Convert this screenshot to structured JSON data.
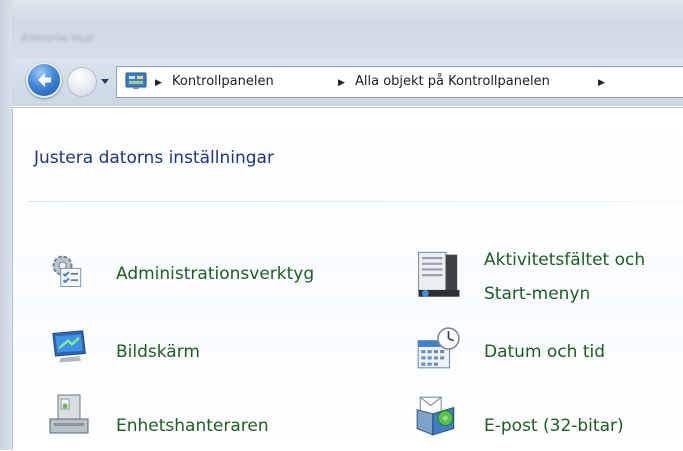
{
  "window": {
    "blurred_title": "Enterprise Vault"
  },
  "address_bar": {
    "breadcrumbs": [
      {
        "label": "Kontrollpanelen"
      },
      {
        "label": "Alla objekt på Kontrollpanelen"
      }
    ]
  },
  "main": {
    "title": "Justera datorns inställningar",
    "items": [
      {
        "label": "Administrationsverktyg",
        "icon": "admin-tools-icon"
      },
      {
        "label_line1": "Aktivitetsfältet och",
        "label_line2": "Start-menyn",
        "icon": "taskbar-icon"
      },
      {
        "label": "Bildskärm",
        "icon": "display-icon"
      },
      {
        "label": "Datum och tid",
        "icon": "calendar-clock-icon"
      },
      {
        "label": "Enhetshanteraren",
        "icon": "device-manager-icon"
      },
      {
        "label": "E-post (32-bitar)",
        "icon": "mail-icon"
      }
    ]
  },
  "colors": {
    "link_green": "#1b5e20",
    "title_blue": "#1e3287",
    "back_button_blue": "#3d82d6"
  }
}
